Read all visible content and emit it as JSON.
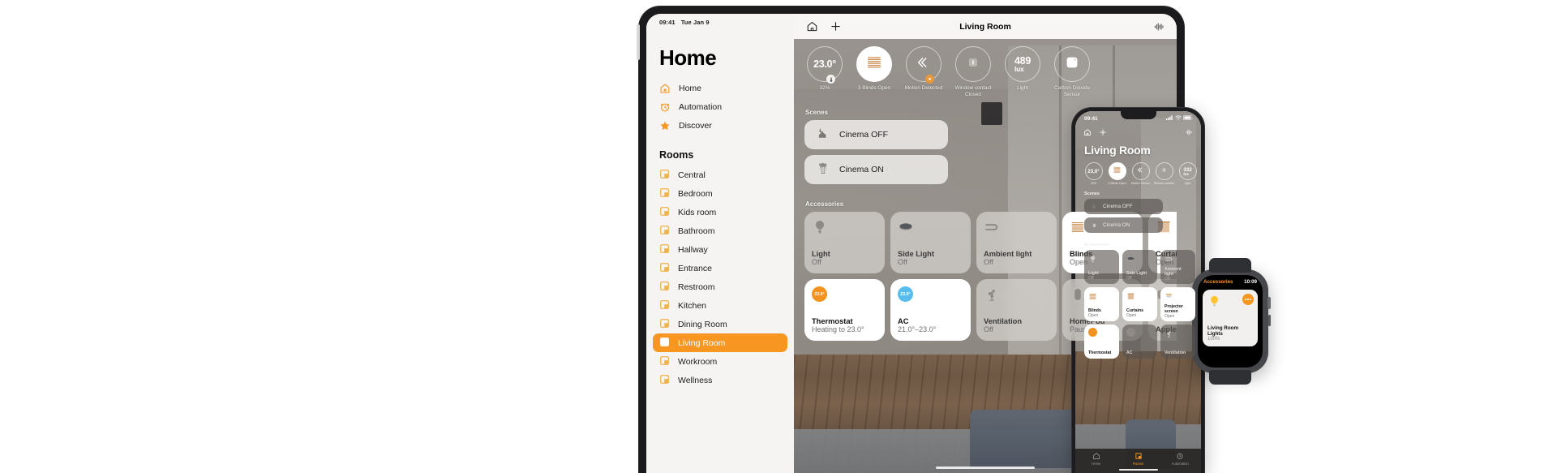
{
  "ipad": {
    "status_bar": {
      "time": "09:41",
      "date": "Tue Jan 9"
    },
    "sidebar": {
      "title": "Home",
      "nav": [
        {
          "label": "Home",
          "icon": "house-icon"
        },
        {
          "label": "Automation",
          "icon": "clock-icon"
        },
        {
          "label": "Discover",
          "icon": "star-icon"
        }
      ],
      "rooms_heading": "Rooms",
      "rooms": [
        {
          "label": "Central",
          "active": false
        },
        {
          "label": "Bedroom",
          "active": false
        },
        {
          "label": "Kids room",
          "active": false
        },
        {
          "label": "Bathroom",
          "active": false
        },
        {
          "label": "Hallway",
          "active": false
        },
        {
          "label": "Entrance",
          "active": false
        },
        {
          "label": "Restroom",
          "active": false
        },
        {
          "label": "Kitchen",
          "active": false
        },
        {
          "label": "Dining Room",
          "active": false
        },
        {
          "label": "Living Room",
          "active": true
        },
        {
          "label": "Workroom",
          "active": false
        },
        {
          "label": "Wellness",
          "active": false
        }
      ]
    },
    "topbar": {
      "title": "Living Room",
      "home_icon": "house-icon",
      "add_icon": "plus-icon",
      "siri_icon": "siri-waveform-icon"
    },
    "status_tiles": [
      {
        "value": "23.0°",
        "unit": "",
        "label": "32%",
        "badge": "thermometer",
        "filled": false,
        "icon": ""
      },
      {
        "value": "",
        "unit": "",
        "label": "3 Blinds Open",
        "badge": "",
        "filled": true,
        "icon": "blinds-icon"
      },
      {
        "value": "",
        "unit": "",
        "label": "Motion Detected",
        "badge": "motion",
        "filled": false,
        "icon": "motion-icon"
      },
      {
        "value": "",
        "unit": "",
        "label": "Window contact Closed",
        "badge": "",
        "filled": false,
        "icon": "window-icon"
      },
      {
        "value": "489",
        "unit": "lux",
        "label": "Light",
        "badge": "",
        "filled": false,
        "icon": ""
      },
      {
        "value": "",
        "unit": "",
        "label": "Carbon Dioxide Sensor",
        "badge": "",
        "filled": false,
        "icon": "co2-icon"
      }
    ],
    "scenes_heading": "Scenes",
    "scenes": [
      {
        "label": "Cinema OFF",
        "icon": "moon-house-icon"
      },
      {
        "label": "Cinema ON",
        "icon": "popcorn-icon"
      }
    ],
    "accessories_heading": "Accessories",
    "accessories_row1": [
      {
        "name": "Light",
        "state": "Off",
        "on": false,
        "icon": "bulb-icon"
      },
      {
        "name": "Side Light",
        "state": "Off",
        "on": false,
        "icon": "puck-light-icon"
      },
      {
        "name": "Ambient light",
        "state": "Off",
        "on": false,
        "icon": "led-strip-icon"
      },
      {
        "name": "Blinds",
        "state": "Open",
        "on": true,
        "icon": "blinds-icon"
      },
      {
        "name": "Curtains",
        "state": "Open",
        "on": true,
        "icon": "curtains-icon"
      }
    ],
    "accessories_row2": [
      {
        "name": "Thermostat",
        "state": "Heating to 23.0°",
        "on": true,
        "icon": "dial-orange",
        "dial": "23.0°"
      },
      {
        "name": "AC",
        "state": "21.0°–23.0°",
        "on": true,
        "icon": "dial-blue",
        "dial": "23.0°"
      },
      {
        "name": "Ventilation",
        "state": "Off",
        "on": false,
        "icon": "fan-icon"
      },
      {
        "name": "HomePod",
        "state": "Paused",
        "on": false,
        "icon": "homepod-icon"
      },
      {
        "name": "Apple",
        "state": "",
        "on": false,
        "icon": "appletv-icon"
      }
    ]
  },
  "iphone": {
    "status_bar": {
      "time": "09:41",
      "signal": "cellular-icon",
      "wifi": "wifi-icon",
      "battery": "battery-icon"
    },
    "topbar": {
      "home_icon": "house-icon",
      "add_icon": "plus-icon",
      "siri_icon": "siri-waveform-icon"
    },
    "title": "Living Room",
    "status_tiles": [
      {
        "value": "23,0°",
        "unit": "",
        "label": "32%",
        "filled": false
      },
      {
        "value": "",
        "unit": "",
        "label": "3 Blinds Open",
        "filled": true
      },
      {
        "value": "",
        "unit": "",
        "label": "Motion Sensor",
        "filled": false
      },
      {
        "value": "",
        "unit": "",
        "label": "Window contact",
        "filled": false
      },
      {
        "value": "332",
        "unit": "lux",
        "label": "Light",
        "filled": false
      }
    ],
    "scenes_heading": "Scenes",
    "scenes": [
      {
        "label": "Cinema OFF",
        "icon": "moon-house-icon"
      },
      {
        "label": "Cinema ON",
        "icon": "popcorn-icon"
      }
    ],
    "accessories_heading": "Accessories",
    "acc_row1": [
      {
        "name": "Light",
        "state": "Off",
        "on": false,
        "icon": "bulb-icon"
      },
      {
        "name": "Side Light",
        "state": "Off",
        "on": false,
        "icon": "puck-light-icon"
      },
      {
        "name": "Ambient light",
        "state": "Off",
        "on": false,
        "icon": "led-strip-icon"
      }
    ],
    "acc_row2": [
      {
        "name": "Blinds",
        "state": "Open",
        "on": true,
        "icon": "blinds-icon"
      },
      {
        "name": "Curtains",
        "state": "Open",
        "on": true,
        "icon": "curtains-icon"
      },
      {
        "name": "Projector screen",
        "state": "Open",
        "on": true,
        "icon": "projector-screen-icon"
      }
    ],
    "acc_row3": [
      {
        "name": "Thermostat",
        "state": "",
        "on": true,
        "icon": "dial-orange"
      },
      {
        "name": "AC",
        "state": "",
        "on": false,
        "icon": "dial-grey"
      },
      {
        "name": "Ventilation",
        "state": "",
        "on": false,
        "icon": "fan-icon"
      }
    ],
    "tabs": [
      {
        "label": "Home",
        "icon": "house-icon",
        "active": false
      },
      {
        "label": "Rooms",
        "icon": "rooms-icon",
        "active": true
      },
      {
        "label": "Automation",
        "icon": "clock-icon",
        "active": false
      }
    ]
  },
  "watch": {
    "header": "Accessories",
    "time": "10:09",
    "card": {
      "name": "Living Room Lights",
      "value": "100%",
      "icon": "bulb-icon",
      "more_icon": "ellipsis-icon"
    }
  },
  "colors": {
    "accent": "#F79621",
    "thermostat": "#F2931F",
    "ac": "#56BDEC",
    "watch_accent": "#F79621"
  }
}
